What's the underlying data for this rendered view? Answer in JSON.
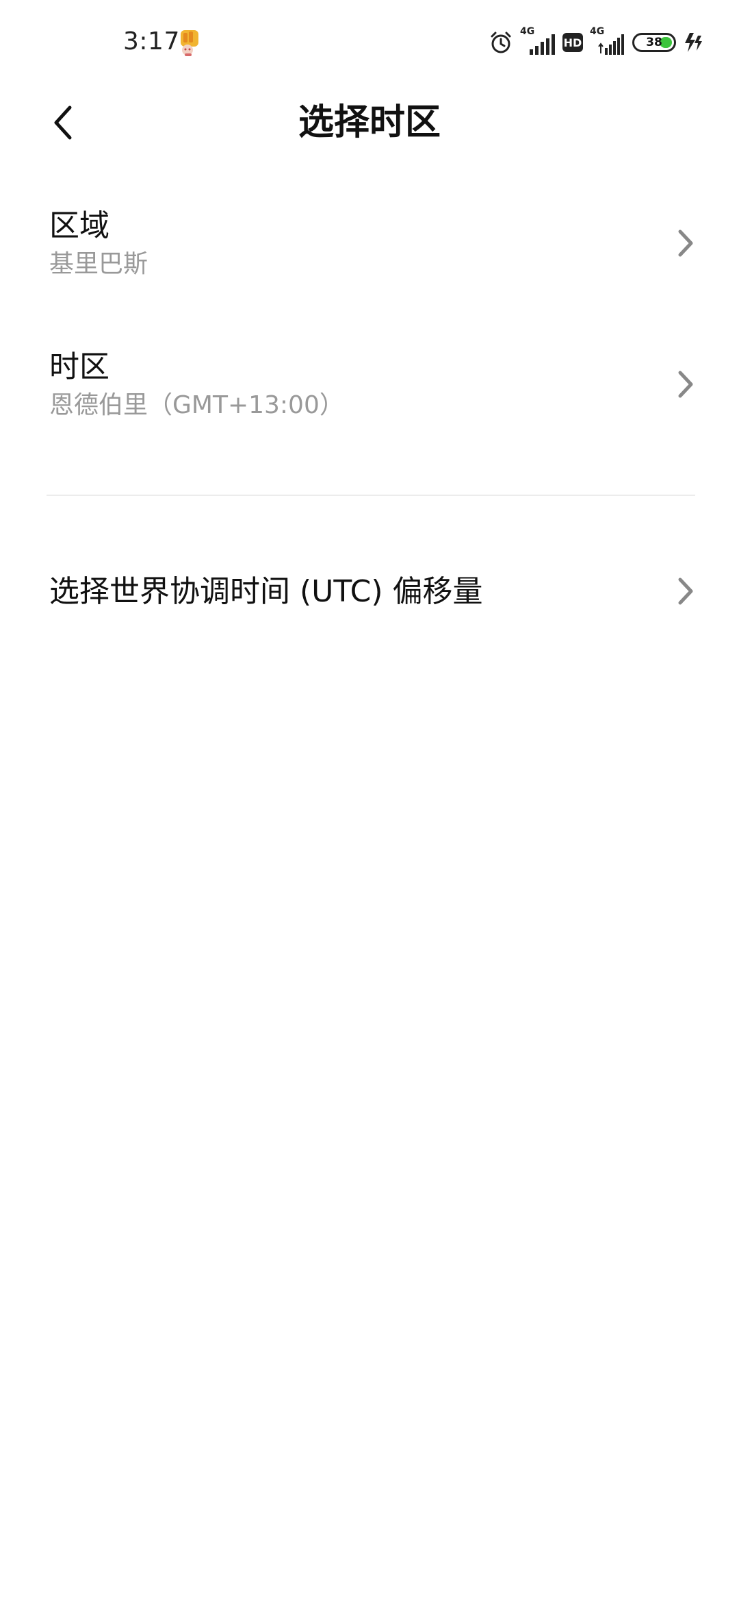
{
  "status_bar": {
    "time": "3:17",
    "network_1": "4G",
    "hd_label": "HD",
    "network_2": "4G",
    "battery_level": "38",
    "battery_color": "#3cc43c"
  },
  "header": {
    "title": "选择时区",
    "back_icon": "chevron-left-icon"
  },
  "settings": {
    "region": {
      "title": "区域",
      "value": "基里巴斯"
    },
    "timezone": {
      "title": "时区",
      "value": "恩德伯里（GMT+13:00）"
    },
    "utc_offset": {
      "title": "选择世界协调时间 (UTC) 偏移量"
    }
  },
  "colors": {
    "text_primary": "#111111",
    "text_secondary": "#999999",
    "chevron": "#888888",
    "divider": "#ececec"
  }
}
